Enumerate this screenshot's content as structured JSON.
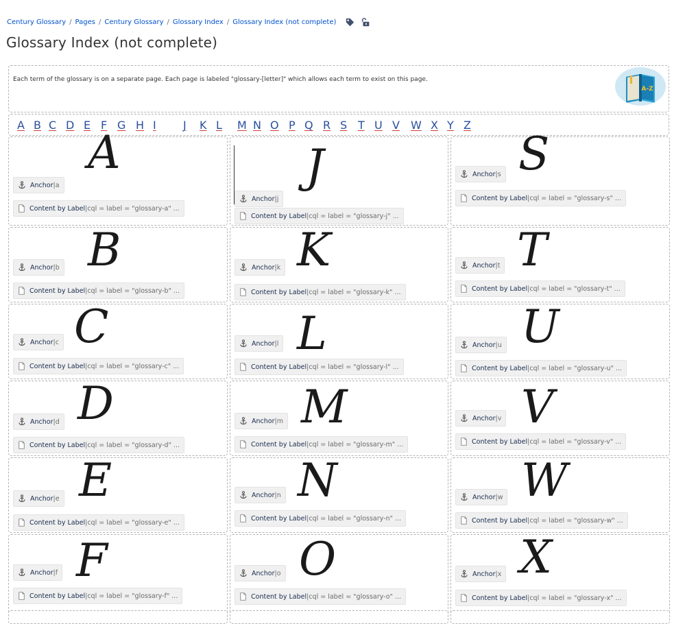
{
  "breadcrumbs": [
    "Century Glossary",
    "Pages",
    "Century Glossary",
    "Glossary Index",
    "Glossary Index (not complete)"
  ],
  "breadcrumb_separator": "/",
  "title": "Glossary Index (not complete)",
  "intro": "Each term of the glossary is on a separate page. Each page is labeled \"glossary-[letter]\" which allows each term to exist on this page.",
  "logo": {
    "text": "A-Z"
  },
  "alphabet": [
    "A",
    "B",
    "C",
    "D",
    "E",
    "F",
    "G",
    "H",
    "I",
    "J",
    "K",
    "L",
    "M",
    "N",
    "O",
    "P",
    "Q",
    "R",
    "S",
    "T",
    "U",
    "V",
    "W",
    "X",
    "Y",
    "Z"
  ],
  "macro": {
    "anchor_name": "Anchor",
    "content_name": "Content by Label",
    "separator": " | "
  },
  "columns": [
    [
      {
        "letter": "A",
        "anchor": "a",
        "cql": "cql = label = \"glossary-a\" ..."
      },
      {
        "letter": "B",
        "anchor": "b",
        "cql": "cql = label = \"glossary-b\" ..."
      },
      {
        "letter": "C",
        "anchor": "c",
        "cql": "cql = label = \"glossary-c\" ..."
      },
      {
        "letter": "D",
        "anchor": "d",
        "cql": "cql = label = \"glossary-d\" ..."
      },
      {
        "letter": "E",
        "anchor": "e",
        "cql": "cql = label = \"glossary-e\" ..."
      },
      {
        "letter": "F",
        "anchor": "f",
        "cql": "cql = label = \"glossary-f\" ..."
      }
    ],
    [
      {
        "letter": "J",
        "anchor": "j",
        "cql": "cql = label = \"glossary-j\" ..."
      },
      {
        "letter": "K",
        "anchor": "k",
        "cql": "cql = label = \"glossary-k\" ..."
      },
      {
        "letter": "L",
        "anchor": "l",
        "cql": "cql = label = \"glossary-l\" ..."
      },
      {
        "letter": "M",
        "anchor": "m",
        "cql": "cql = label = \"glossary-m\" ..."
      },
      {
        "letter": "N",
        "anchor": "n",
        "cql": "cql = label = \"glossary-n\" ..."
      },
      {
        "letter": "O",
        "anchor": "o",
        "cql": "cql = label = \"glossary-o\" ..."
      }
    ],
    [
      {
        "letter": "S",
        "anchor": "s",
        "cql": "cql = label = \"glossary-s\" ..."
      },
      {
        "letter": "T",
        "anchor": "t",
        "cql": "cql = label = \"glossary-t\" ..."
      },
      {
        "letter": "U",
        "anchor": "u",
        "cql": "cql = label = \"glossary-u\" ..."
      },
      {
        "letter": "V",
        "anchor": "v",
        "cql": "cql = label = \"glossary-v\" ..."
      },
      {
        "letter": "W",
        "anchor": "w",
        "cql": "cql = label = \"glossary-w\" ..."
      },
      {
        "letter": "X",
        "anchor": "x",
        "cql": "cql = label = \"glossary-x\" ..."
      }
    ]
  ],
  "colors": {
    "link": "#0052cc",
    "alpha_link": "#2a4f9d",
    "macro_bg": "#f0f0f0",
    "border": "#b3b3b3"
  },
  "icons": {
    "tag": "tag-icon",
    "restrictions": "unlock-icon",
    "anchor": "anchor-icon",
    "page": "page-icon"
  }
}
